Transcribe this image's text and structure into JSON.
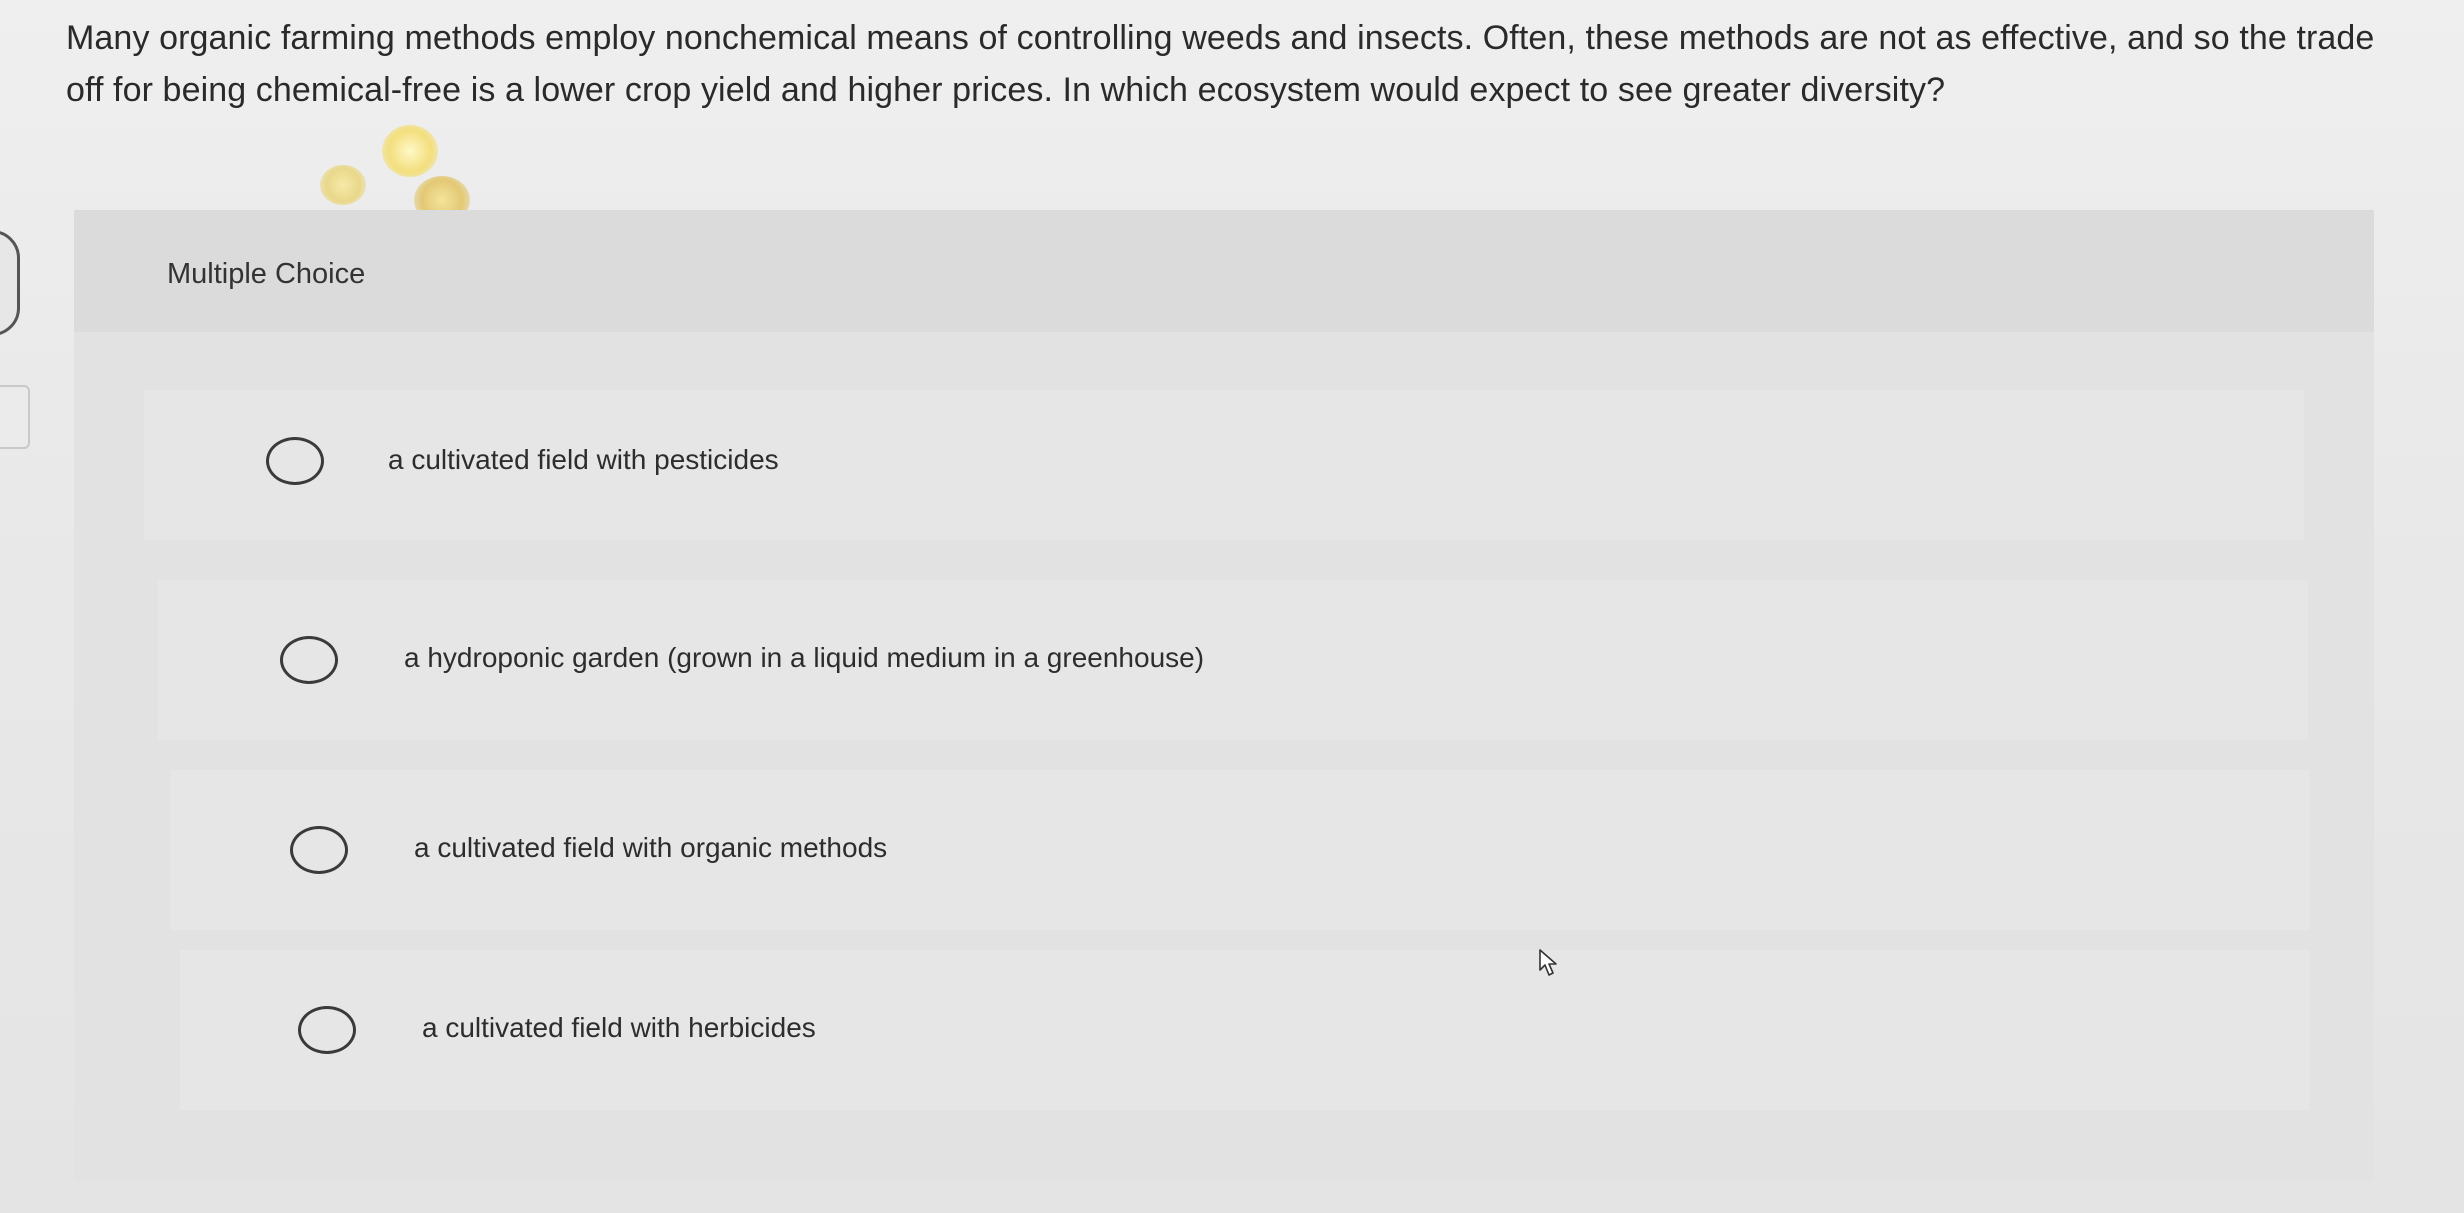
{
  "question": {
    "text": "Many organic farming methods employ nonchemical means of controlling weeds and insects. Often, these methods are not as effective, and so the trade off for being chemical-free is a lower crop yield and higher prices. In which ecosystem would expect to see greater diversity?"
  },
  "multiple_choice": {
    "label": "Multiple Choice",
    "options": [
      {
        "label": "a cultivated field with pesticides",
        "selected": false
      },
      {
        "label": "a hydroponic garden (grown in a liquid medium in a greenhouse)",
        "selected": false
      },
      {
        "label": "a cultivated field with organic methods",
        "selected": false
      },
      {
        "label": "a cultivated field with herbicides",
        "selected": false
      }
    ]
  },
  "icons": {
    "cursor": "mouse-pointer-icon",
    "radio": "radio-circle-icon"
  }
}
